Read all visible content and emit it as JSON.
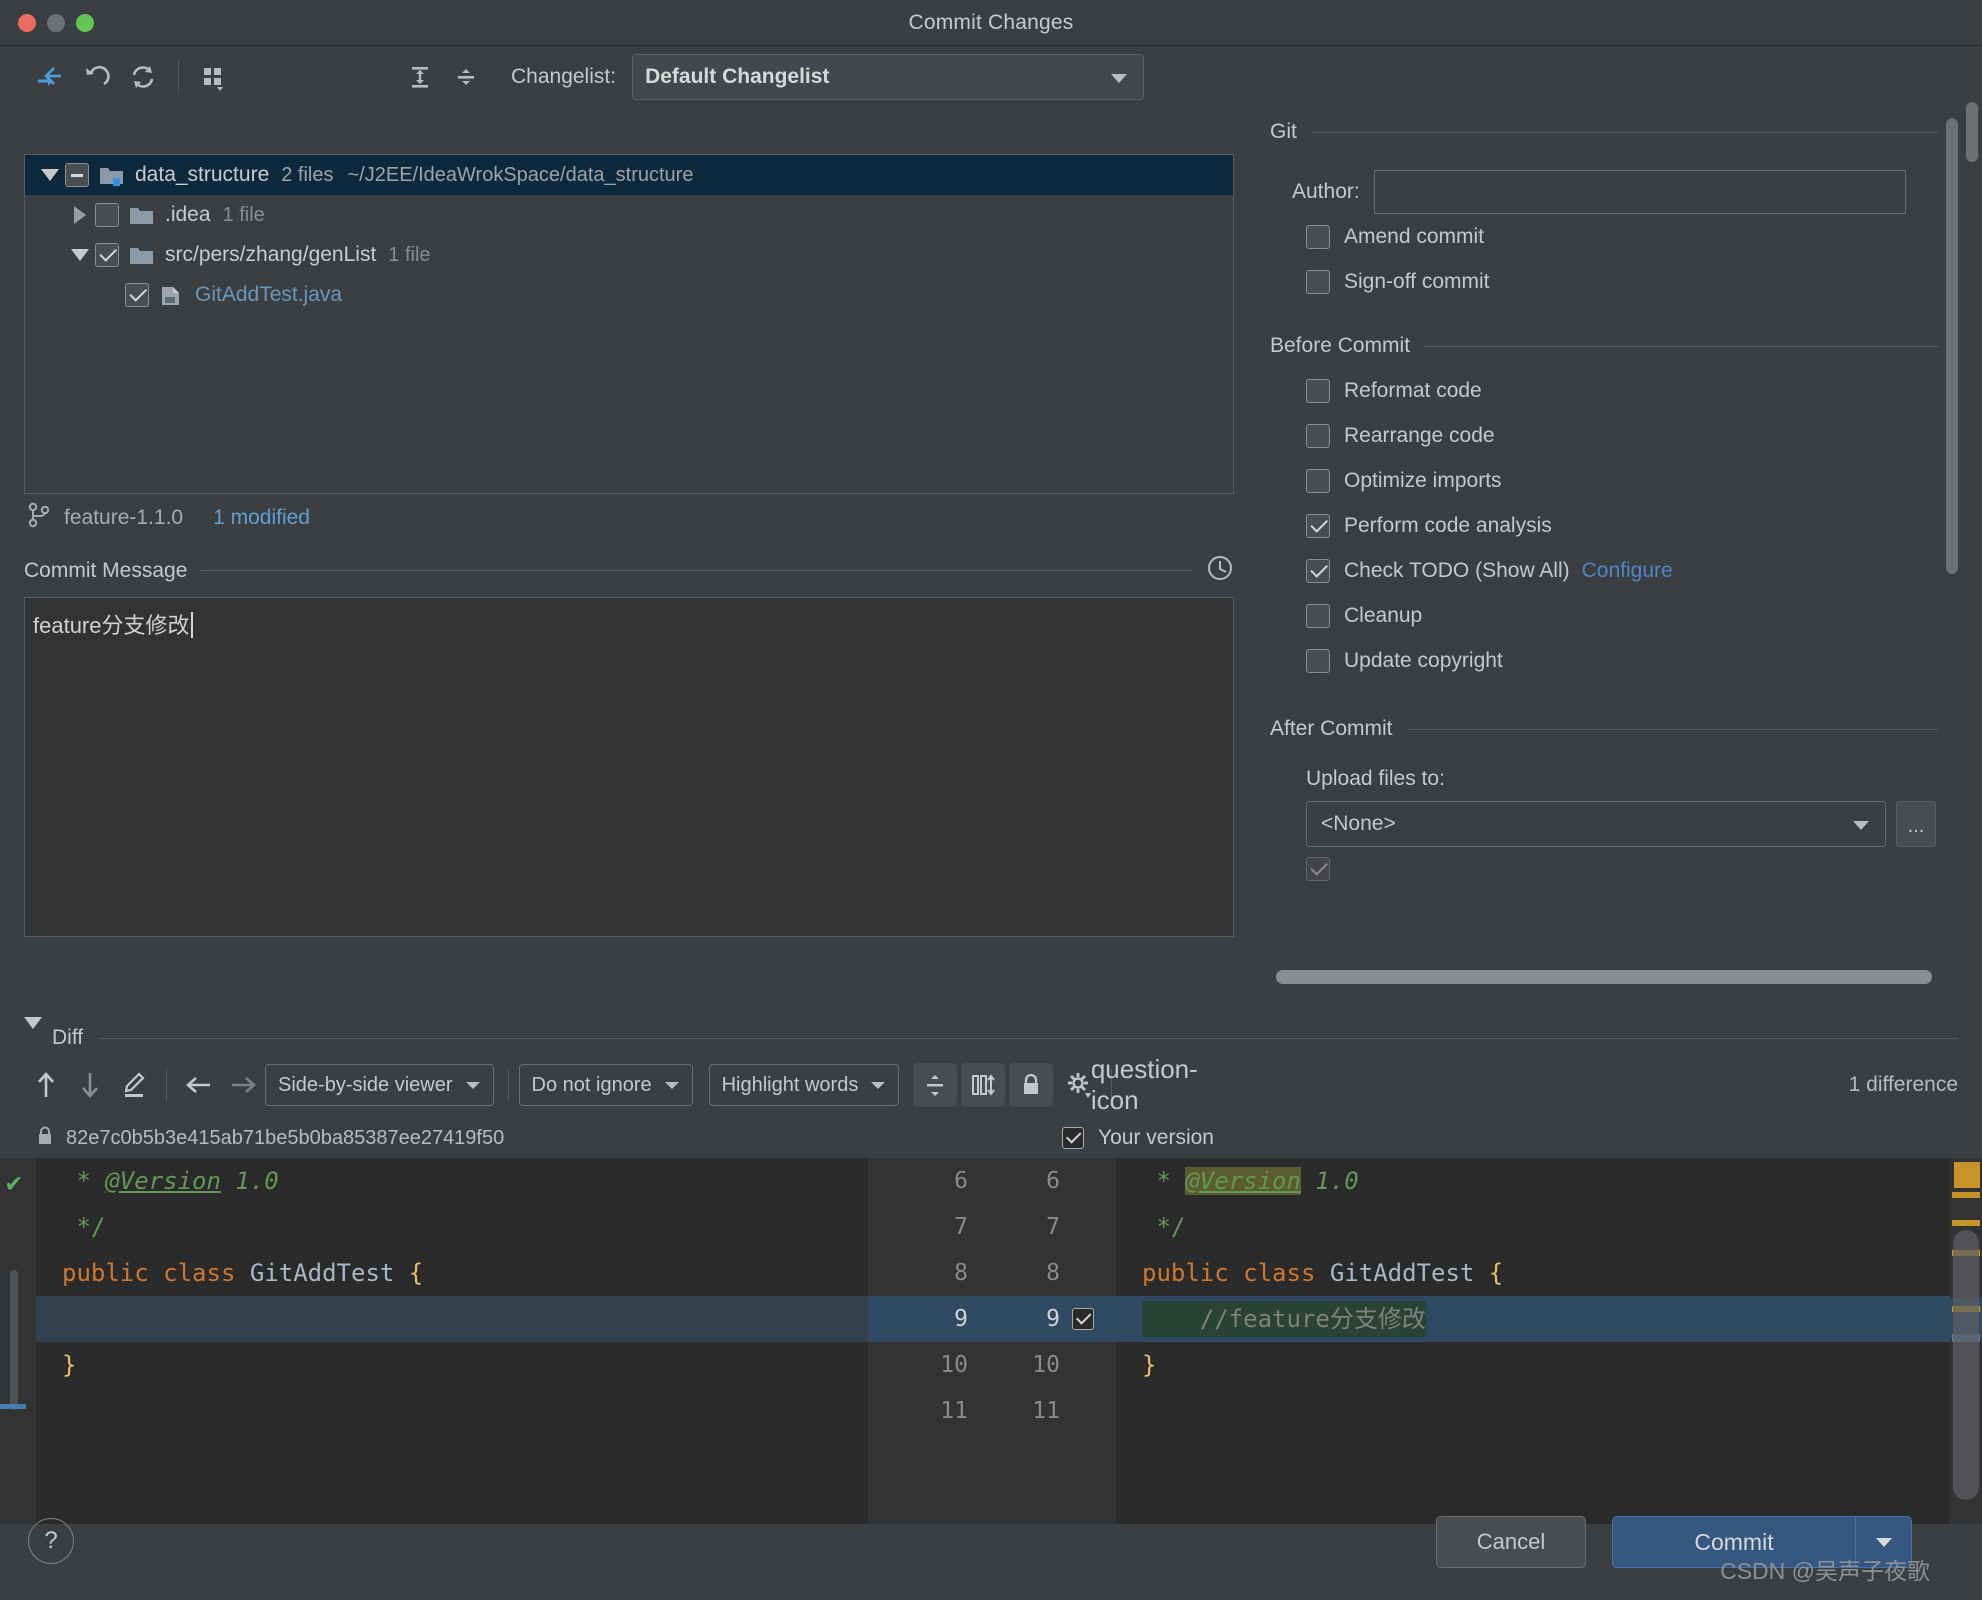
{
  "window": {
    "title": "Commit Changes",
    "traffic_lights": [
      "close",
      "minimize",
      "zoom"
    ]
  },
  "toolbar": {
    "icons": [
      "show-diff-icon",
      "revert-icon",
      "refresh-icon",
      "group-by-icon",
      "expand-all-icon",
      "collapse-all-icon"
    ],
    "changelist_label": "Changelist:",
    "changelist_value": "Default Changelist"
  },
  "file_tree": {
    "rows": [
      {
        "name": "data_structure",
        "meta": "2 files",
        "path": "~/J2EE/IdeaWrokSpace/data_structure",
        "state": "partial",
        "twisty": "down",
        "selected": true,
        "kind": "module"
      },
      {
        "name": ".idea",
        "meta": "1 file",
        "path": "",
        "state": "unchecked",
        "twisty": "right",
        "selected": false,
        "kind": "folder"
      },
      {
        "name": "src/pers/zhang/genList",
        "meta": "1 file",
        "path": "",
        "state": "checked",
        "twisty": "down",
        "selected": false,
        "kind": "folder"
      },
      {
        "name": "GitAddTest.java",
        "meta": "",
        "path": "",
        "state": "checked",
        "twisty": "none",
        "selected": false,
        "kind": "java-file"
      }
    ]
  },
  "branch": {
    "icon": "branch-icon",
    "name": "feature-1.1.0",
    "modified": "1 modified"
  },
  "commit_message": {
    "label": "Commit Message",
    "history_icon": "clock-icon",
    "value": "feature分支修改"
  },
  "git_panel": {
    "group_title": "Git",
    "author_label": "Author:",
    "author_value": "",
    "options": [
      {
        "label": "Amend commit",
        "checked": false
      },
      {
        "label": "Sign-off commit",
        "checked": false
      }
    ]
  },
  "before_commit": {
    "group_title": "Before Commit",
    "options": [
      {
        "label": "Reformat code",
        "checked": false,
        "link": ""
      },
      {
        "label": "Rearrange code",
        "checked": false,
        "link": ""
      },
      {
        "label": "Optimize imports",
        "checked": false,
        "link": ""
      },
      {
        "label": "Perform code analysis",
        "checked": true,
        "link": ""
      },
      {
        "label": "Check TODO (Show All)",
        "checked": true,
        "link": "Configure"
      },
      {
        "label": "Cleanup",
        "checked": false,
        "link": ""
      },
      {
        "label": "Update copyright",
        "checked": false,
        "link": ""
      }
    ]
  },
  "after_commit": {
    "group_title": "After Commit",
    "upload_label": "Upload files to:",
    "upload_value": "<None>",
    "browse_label": "..."
  },
  "diff": {
    "section_label": "Diff",
    "toolbar": {
      "prev_diff_icon": "arrow-up-icon",
      "next_diff_icon": "arrow-down-icon",
      "annotate_icon": "pencil-icon",
      "apply_left_icon": "arrow-left-icon",
      "apply_right_icon": "arrow-right-icon",
      "viewer_mode": "Side-by-side viewer",
      "whitespace_mode": "Do not ignore",
      "highlight_mode": "Highlight words",
      "collapse_unchanged_icon": "collapse-icon",
      "synchronize_icon": "sync-scroll-icon",
      "read_only_icon": "lock-icon",
      "settings_icon": "gear-icon",
      "help_icon": "question-icon",
      "difference_count": "1 difference"
    },
    "left_header": {
      "lock_icon": "lock-icon",
      "revision": "82e7c0b5b3e415ab71be5b0ba85387ee27419f50"
    },
    "right_header": {
      "checked": true,
      "label": "Your version"
    },
    "left_lines": [
      {
        "text": " * @Version 1.0",
        "type": "comment"
      },
      {
        "text": " */",
        "type": "comment"
      },
      {
        "text": "public class GitAddTest {",
        "type": "code"
      },
      {
        "text": "",
        "type": "empty-highlight"
      },
      {
        "text": "}",
        "type": "code"
      }
    ],
    "line_numbers": [
      {
        "left": "6",
        "right": "6",
        "checkbox": false,
        "highlight": false
      },
      {
        "left": "7",
        "right": "7",
        "checkbox": false,
        "highlight": false
      },
      {
        "left": "8",
        "right": "8",
        "checkbox": false,
        "highlight": false
      },
      {
        "left": "9",
        "right": "9",
        "checkbox": true,
        "highlight": true
      },
      {
        "left": "10",
        "right": "10",
        "checkbox": false,
        "highlight": false
      },
      {
        "left": "11",
        "right": "11",
        "checkbox": false,
        "highlight": false
      }
    ],
    "right_lines": [
      {
        "text": " * @Version 1.0",
        "type": "comment-token-highlight"
      },
      {
        "text": " */",
        "type": "comment"
      },
      {
        "text": "public class GitAddTest {",
        "type": "code"
      },
      {
        "text": "    //feature分支修改",
        "type": "added-comment"
      },
      {
        "text": "}",
        "type": "code"
      }
    ]
  },
  "bottom_bar": {
    "help_label": "?",
    "cancel_label": "Cancel",
    "commit_label": "Commit",
    "commit_dropdown_icon": "chevron-down-icon",
    "watermark": "CSDN @吴声子夜歌"
  },
  "colors": {
    "accent_blue": "#4b6eaf",
    "commit_button": "#365880",
    "link": "#4d86c9",
    "selection": "#0d293e",
    "added_line": "#294436",
    "keyword_orange": "#cc7832",
    "comment_green": "#629755",
    "brace_yellow": "#e8bf6a"
  }
}
